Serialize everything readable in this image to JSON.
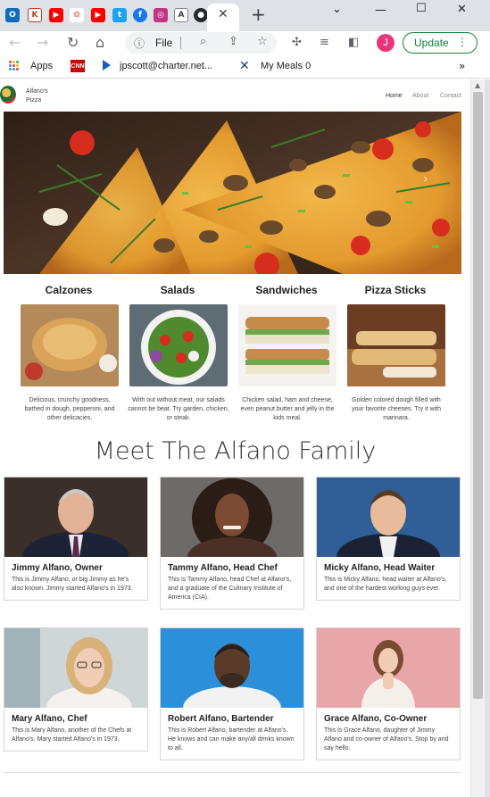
{
  "browser": {
    "tabs": [
      {
        "icon": "outlook-icon",
        "glyph": "O",
        "color": "#0f6cbd"
      },
      {
        "icon": "tab-icon-k",
        "glyph": "K",
        "color": "#c0392b"
      },
      {
        "icon": "youtube-icon",
        "glyph": "▶",
        "color": "#ff0000"
      },
      {
        "icon": "tab-icon-red",
        "glyph": "✿",
        "color": "#ff6f61"
      },
      {
        "icon": "youtube-icon",
        "glyph": "▶",
        "color": "#ff0000"
      },
      {
        "icon": "twitter-icon",
        "glyph": "t",
        "color": "#1da1f2"
      },
      {
        "icon": "facebook-icon",
        "glyph": "f",
        "color": "#1877f2"
      },
      {
        "icon": "instagram-icon",
        "glyph": "◎",
        "color": "#c13584"
      },
      {
        "icon": "tab-icon-a",
        "glyph": "A",
        "color": "#444444"
      },
      {
        "icon": "github-icon",
        "glyph": "●",
        "color": "#24292e"
      }
    ],
    "tab_close": "✕",
    "new_tab": "+",
    "window": {
      "chevron": "⌄",
      "minimize": "—",
      "maximize": "☐",
      "close": "✕"
    },
    "address": {
      "scheme_label": "File"
    },
    "profile_initial": "J",
    "update_label": "Update",
    "bookmarks": {
      "apps": "Apps",
      "email": "jpscott@charter.net...",
      "meals": "My Meals 0",
      "more": "»"
    }
  },
  "site": {
    "brand_line1": "Alfano's",
    "brand_line2": "Pizza",
    "nav": [
      "Home",
      "About",
      "Contact"
    ],
    "categories": [
      {
        "title": "Calzones",
        "desc": "Delicious, crunchy goodness, bathed in dough, pepperoni, and other delicacies."
      },
      {
        "title": "Salads",
        "desc": "With out without meat, our salads cannot be beat. Try garden, chicken, or steak."
      },
      {
        "title": "Sandwiches",
        "desc": "Chicken salad, ham and cheese, even peanut butter and jelly in the kids meal."
      },
      {
        "title": "Pizza Sticks",
        "desc": "Golden colored dough filled with your favorite cheeses. Try it with marinara."
      }
    ],
    "family_title": "Meet The Alfano Family",
    "family": [
      {
        "name": "Jimmy Alfano, Owner",
        "bio": "This is Jimmy Alfano, or big Jimmy as he's also known. Jimmy started Alfano's in 1973."
      },
      {
        "name": "Tammy Alfano, Head Chef",
        "bio": "This is Tammy Alfano, head Chef at Alfano's, and a graduate of the Culinary Institute of America (CIA)."
      },
      {
        "name": "Micky Alfano, Head Waiter",
        "bio": "This is Micky Alfano, head waiter at Alfano's, and one of the hardest working guys ever."
      },
      {
        "name": "Mary Alfano, Chef",
        "bio": "This is Mary Alfano, another of the Chefs at Alfano's. Mary started Alfano's in 1973."
      },
      {
        "name": "Robert Alfano, Bartender",
        "bio": "This is Robert Alfano, bartender at Alfano's. He knows and can make any/all drinks known to all."
      },
      {
        "name": "Grace Alfano, Co-Owner",
        "bio": "This is Grace Alfano, daughter of Jimmy Alfano and co-owner of Alfano's. Stop by and say hello."
      }
    ]
  }
}
